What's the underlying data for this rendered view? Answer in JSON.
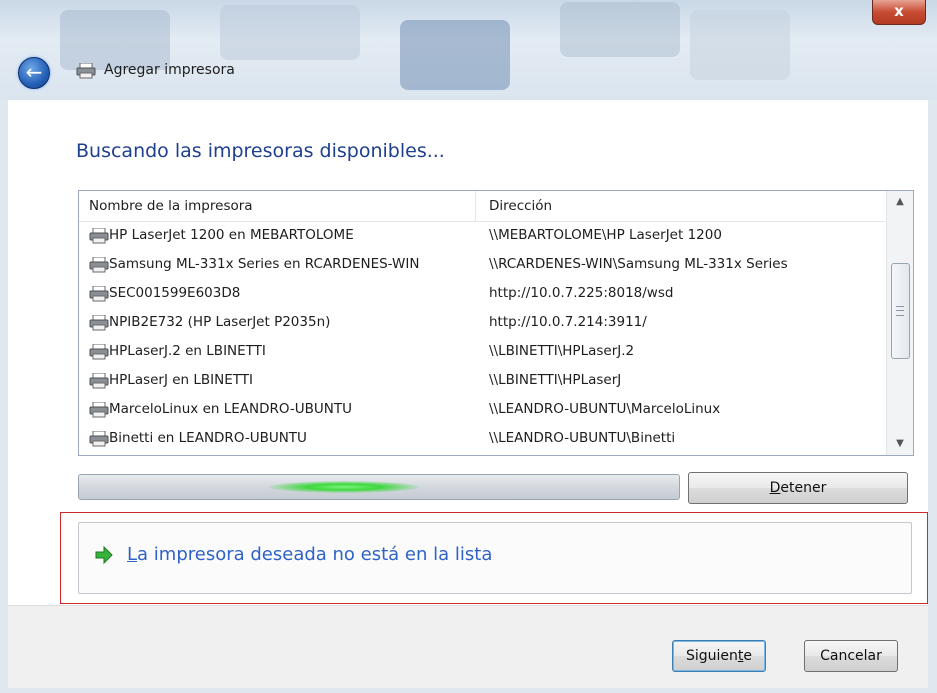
{
  "window": {
    "title": "Agregar impresora",
    "close_glyph": "x",
    "back_glyph": "←"
  },
  "heading": "Buscando las impresoras disponibles...",
  "list": {
    "columns": [
      "Nombre de la impresora",
      "Dirección"
    ],
    "rows": [
      {
        "name": "HP LaserJet 1200 en MEBARTOLOME",
        "address": "\\\\MEBARTOLOME\\HP LaserJet 1200"
      },
      {
        "name": "Samsung ML-331x Series en RCARDENES-WIN",
        "address": "\\\\RCARDENES-WIN\\Samsung ML-331x Series"
      },
      {
        "name": "SEC001599E603D8",
        "address": "http://10.0.7.225:8018/wsd"
      },
      {
        "name": "NPIB2E732 (HP LaserJet P2035n)",
        "address": "http://10.0.7.214:3911/"
      },
      {
        "name": "HPLaserJ.2 en LBINETTI",
        "address": "\\\\LBINETTI\\HPLaserJ.2"
      },
      {
        "name": "HPLaserJ en LBINETTI",
        "address": "\\\\LBINETTI\\HPLaserJ"
      },
      {
        "name": "MarceloLinux en LEANDRO-UBUNTU",
        "address": "\\\\LEANDRO-UBUNTU\\MarceloLinux"
      },
      {
        "name": "Binetti en LEANDRO-UBUNTU",
        "address": "\\\\LEANDRO-UBUNTU\\Binetti"
      }
    ],
    "scroll_up_glyph": "▲",
    "scroll_down_glyph": "▼"
  },
  "stop_button": {
    "label_pre": "",
    "label_u": "D",
    "label_post": "etener"
  },
  "link": {
    "pre": "",
    "u": "L",
    "post": "a impresora deseada no está en la lista"
  },
  "footer": {
    "next": {
      "pre": "Siguien",
      "u": "t",
      "post": "e"
    },
    "cancel": "Cancelar"
  },
  "icons": {
    "back": "back-arrow-icon",
    "printer": "printer-icon",
    "link_arrow": "green-arrow-icon",
    "close": "close-icon"
  },
  "colors": {
    "heading": "#1f3f8f",
    "link": "#2f62c8",
    "close": "#c84c34",
    "highlight_box": "#cc2a2a",
    "progress_glow": "#3fd83f"
  }
}
